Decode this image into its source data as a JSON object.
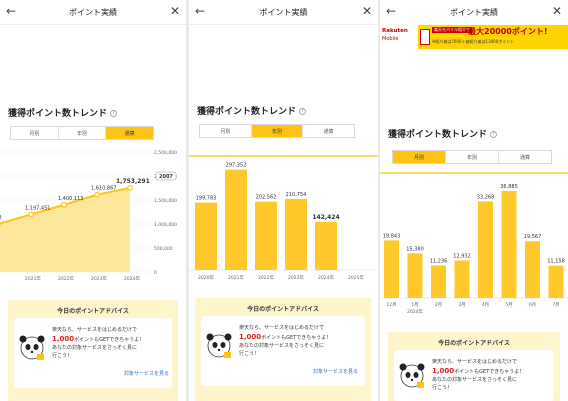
{
  "colors": {
    "accent": "#ffc413",
    "bar": "#ffc92b",
    "area": "#fde79a",
    "link": "#2a6ec7",
    "highlight_text": "#e02020",
    "brand_red": "#bf0000"
  },
  "panel1": {
    "header": {
      "title": "ポイント実績",
      "back_icon": "←",
      "close_icon": "✕"
    },
    "section_title": "獲得ポイント数トレンド",
    "tabs": [
      "月別",
      "年別",
      "通算"
    ],
    "active_tab": 2,
    "chart_data": {
      "type": "area",
      "x": [
        "2020年",
        "2021年",
        "2022年",
        "2023年",
        "2024年"
      ],
      "x_labels": [
        "0年",
        "2021年",
        "2022年",
        "2023年",
        "2024年"
      ],
      "values": [
        1000000,
        1197451,
        1400113,
        1610867,
        1753291
      ],
      "value_labels": [
        "098",
        "1,197,451",
        "1,400,113",
        "1,610,867",
        "1,753,291"
      ],
      "y_ticks": [
        "2,500,000",
        "2,000,000",
        "1,500,000",
        "1,000,000",
        "500,000",
        "0"
      ],
      "y_marker": "2007",
      "ylim": [
        0,
        2500000
      ]
    },
    "advice": {
      "title": "今日のポイントアドバイス",
      "line1": "楽天なら、サービスをはじめるだけで",
      "highlight": "1,000",
      "line2": "ポイントもGETできちゃうよ！",
      "line3": "あなたの対象サービスをさっそく見に",
      "line4": "行こう！",
      "link": "対象サービスを見る"
    }
  },
  "panel2": {
    "header": {
      "title": "ポイント実績",
      "back_icon": "←",
      "close_icon": "✕"
    },
    "section_title": "獲得ポイント数トレンド",
    "tabs": [
      "月別",
      "年別",
      "通算"
    ],
    "active_tab": 1,
    "chart_data": {
      "type": "bar",
      "categories": [
        "2020年",
        "2021年",
        "2022年",
        "2023年",
        "2024年",
        "2025年"
      ],
      "values": [
        199783,
        297352,
        202562,
        210754,
        142424,
        0
      ],
      "value_labels": [
        "199,783",
        "297,352",
        "202,562",
        "210,754",
        "142,424",
        ""
      ],
      "highlight_index": 4,
      "ylim": [
        0,
        320000
      ]
    },
    "advice": {
      "title": "今日のポイントアドバイス",
      "line1": "楽天なら、サービスをはじめるだけで",
      "highlight": "1,000",
      "line2": "ポイントもGETできちゃうよ！",
      "line3": "あなたの対象サービスをさっそく見に",
      "line4": "行こう！",
      "link": "対象サービスを見る"
    }
  },
  "panel3": {
    "header": {
      "title": "ポイント実績",
      "back_icon": "←",
      "close_icon": "✕"
    },
    "banner": {
      "logo_line1": "Rakuten",
      "logo_line2": "Mobile",
      "pill": "楽天モバイル紹介で",
      "headline": "最大20000ポイント!",
      "sub": "※紹介者は7000＋被紹介者は13000ポイント"
    },
    "section_title": "獲得ポイント数トレンド",
    "tabs": [
      "月別",
      "年別",
      "通算"
    ],
    "active_tab": 0,
    "chart_data": {
      "type": "bar",
      "categories": [
        "12月",
        "1月",
        "2月",
        "3月",
        "4月",
        "5月",
        "6月",
        "7月"
      ],
      "values": [
        19843,
        15380,
        11236,
        12932,
        33268,
        36885,
        19567,
        11158
      ],
      "value_labels": [
        "19,843",
        "15,380",
        "11,236",
        "12,932",
        "33,268",
        "36,885",
        "19,567",
        "11,158"
      ],
      "year_label": "2024年",
      "ylim": [
        0,
        42000
      ]
    },
    "advice": {
      "title": "今日のポイントアドバイス",
      "line1": "楽天なら、サービスをはじめるだけで",
      "highlight": "1,000",
      "line2": "ポイントもGETできちゃうよ！",
      "line3": "あなたの対象サービスをさっそく見に",
      "line4": "行こう！"
    }
  }
}
